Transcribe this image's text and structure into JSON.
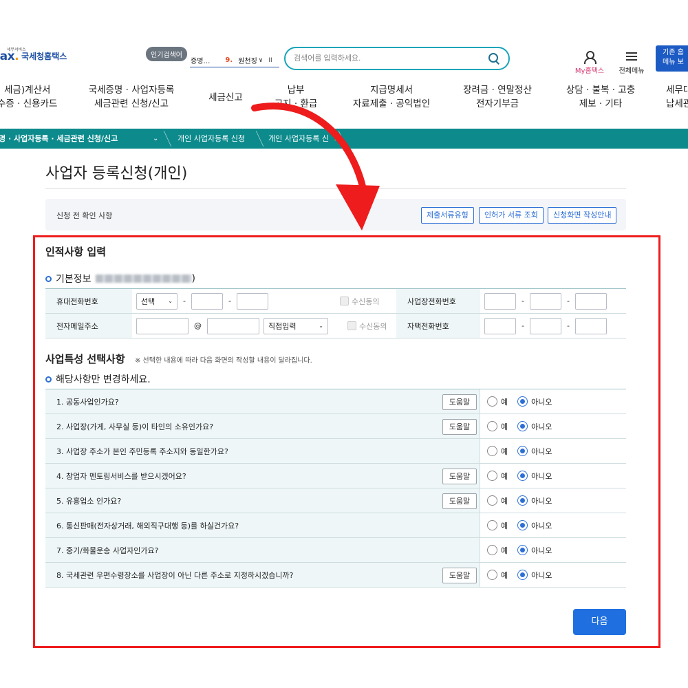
{
  "header": {
    "logo_small": "세무서비스",
    "logo_tx": "tax",
    "logo_dot": ".",
    "logo_name": "국세청홈택스",
    "popular_tag": "인기검색어",
    "popular_item1": "증명…",
    "popular_rank": "9.",
    "popular_item2": "원천징",
    "popular_chev": "∨",
    "popular_pause": "II",
    "search_placeholder": "검색어를 입력하세요.",
    "my_home": "My홈택스",
    "all_menu": "전체메뉴",
    "old_btn_line1": "기존 홈",
    "old_btn_line2": "메뉴 보"
  },
  "gnb": [
    {
      "l1": "세금)계산서",
      "l2": "수증 · 신용카드"
    },
    {
      "l1": "국세증명 · 사업자등록",
      "l2": "세금관련 신청/신고"
    },
    {
      "l1": "세금신고",
      "l2": ""
    },
    {
      "l1": "납부",
      "l2": "고지 · 환급"
    },
    {
      "l1": "지급명세서",
      "l2": "자료제출 · 공익법인"
    },
    {
      "l1": "장려금 · 연말정산",
      "l2": "전자기부금"
    },
    {
      "l1": "상담 · 불복 · 고충",
      "l2": "제보 · 기타"
    },
    {
      "l1": "세무대",
      "l2": "납세관"
    }
  ],
  "breadcrumb": {
    "seg1": "명 · 사업자등록 · 세금관련 신청/신고",
    "seg2": "개인 사업자등록 신청",
    "seg3": "개인 사업자등록 신"
  },
  "page": {
    "title": "사업자 등록신청(개인)",
    "pre_check_label": "신청 전 확인 사항",
    "pre_buttons": [
      "제출서류유형",
      "인허가 서류 조회",
      "신청화면 작성안내"
    ]
  },
  "identity": {
    "heading": "인적사항 입력",
    "basic_info": "기본정보",
    "basic_info_close": ")",
    "mobile_label": "휴대전화번호",
    "mobile_select": "선택",
    "dash": "-",
    "consent": "수신동의",
    "biz_phone_label": "사업장전화번호",
    "email_label": "전자메일주소",
    "at": "@",
    "email_domain_select": "직접입력",
    "home_phone_label": "자택전화번호"
  },
  "business": {
    "heading": "사업특성 선택사항",
    "note": "※ 선택한 내용에 따라 다음 화면의 작성할 내용이 달라집니다.",
    "sub_heading": "해당사항만 변경하세요.",
    "help_label": "도움말",
    "yes_label": "예",
    "no_label": "아니오",
    "questions": [
      {
        "text": "1. 공동사업인가요?",
        "help": true,
        "answer": "no"
      },
      {
        "text": "2. 사업장(가게, 사무실 등)이 타인의 소유인가요?",
        "help": true,
        "answer": "no"
      },
      {
        "text": "3. 사업장 주소가 본인 주민등록 주소지와 동일한가요?",
        "help": false,
        "answer": "no"
      },
      {
        "text": "4. 창업자 멘토링서비스를 받으시겠어요?",
        "help": true,
        "answer": "no"
      },
      {
        "text": "5. 유흥업소 인가요?",
        "help": true,
        "answer": "no"
      },
      {
        "text": "6. 통신판매(전자상거래, 해외직구대행 등)를 하실건가요?",
        "help": false,
        "answer": "no"
      },
      {
        "text": "7. 중기/화물운송 사업자인가요?",
        "help": false,
        "answer": "no"
      },
      {
        "text": "8. 국세관련 우편수령장소를 사업장이 아닌 다른 주소로 지정하시겠습니까?",
        "help": true,
        "answer": "no"
      }
    ]
  },
  "next_button": "다음",
  "colors": {
    "accent": "#1f6fe0",
    "breadcrumb": "#0c8a8c",
    "highlight": "#ee1c1c"
  }
}
